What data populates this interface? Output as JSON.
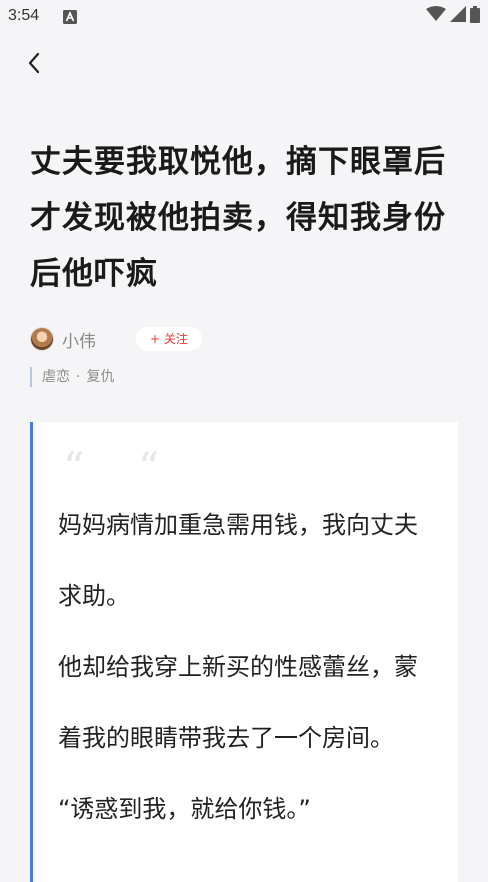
{
  "status_bar": {
    "time": "3:54",
    "notification_icon": "a-icon",
    "wifi_icon": "wifi-icon",
    "signal_icon": "signal-icon",
    "battery_icon": "battery-icon"
  },
  "nav": {
    "back_icon": "chevron-left-icon"
  },
  "article": {
    "title": "丈夫要我取悦他，摘下眼罩后才发现被他拍卖，得知我身份后他吓疯",
    "author": {
      "name": "小伟",
      "follow_label": "+ 关注"
    },
    "tags": [
      "虐恋",
      "复仇"
    ],
    "tag_separator": "·",
    "quote_glyph": "“ “",
    "paragraphs": [
      "妈妈病情加重急需用钱，我向丈夫求助。",
      "他却给我穿上新买的性感蕾丝，蒙着我的眼睛带我去了一个房间。",
      "“诱惑到我，就给你钱。”"
    ]
  },
  "colors": {
    "accent_bar": "#4a7bd9",
    "follow_text": "#e53935",
    "tag_bar": "#b8c6e6",
    "background": "#f5f5f7"
  }
}
